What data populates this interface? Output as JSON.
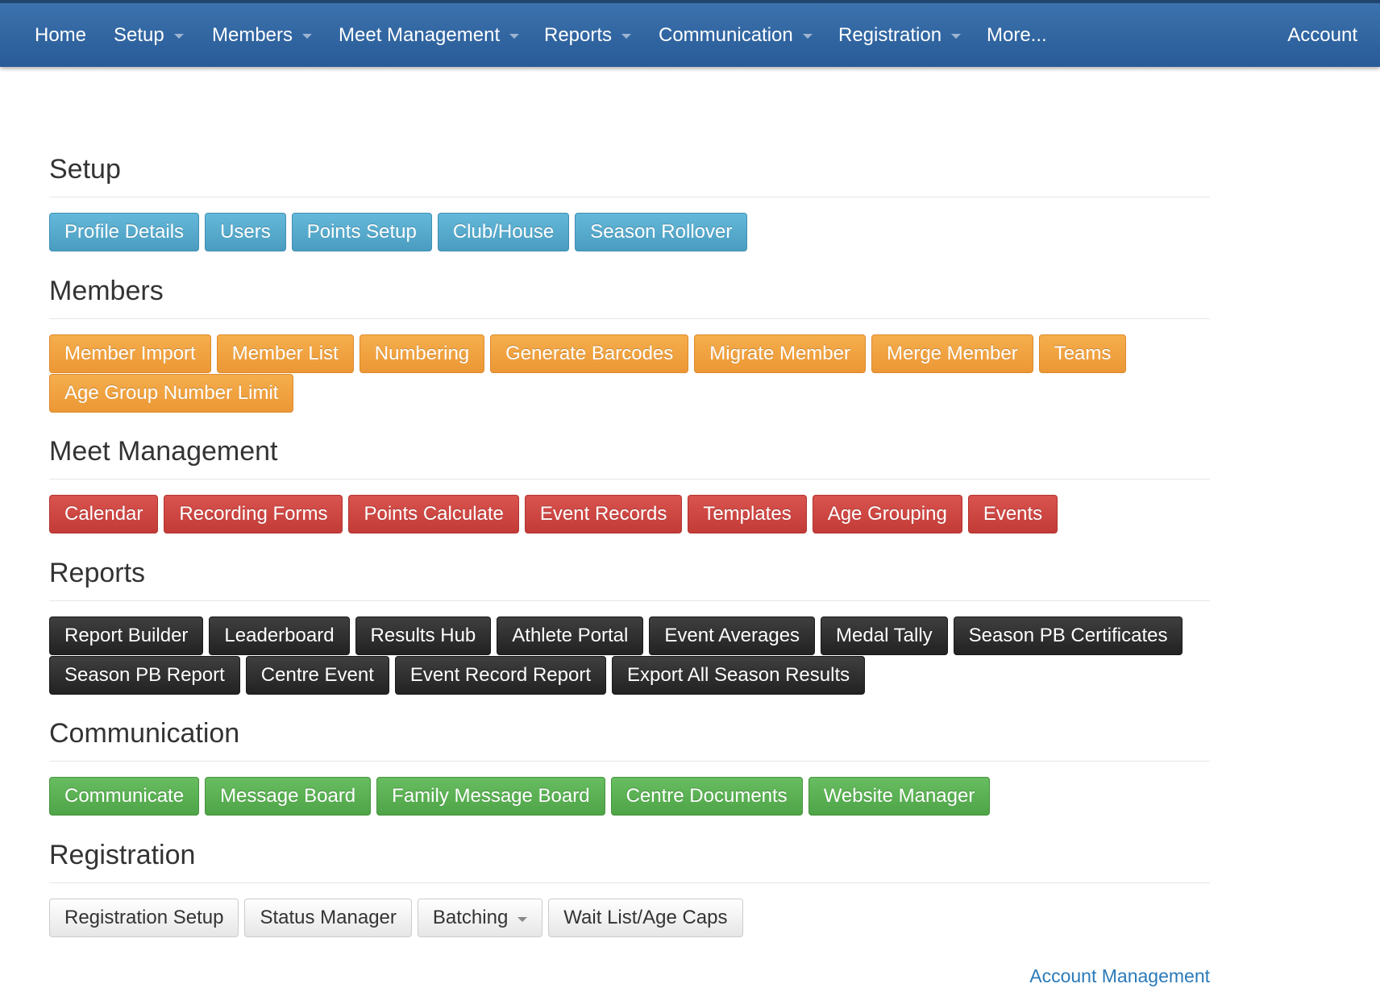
{
  "navbar": {
    "home": "Home",
    "setup": "Setup",
    "members": "Members",
    "meet_management": "Meet Management",
    "reports": "Reports",
    "communication": "Communication",
    "registration": "Registration",
    "more": "More...",
    "account": "Account",
    "bg_color": "#2d64a0"
  },
  "sections": {
    "setup": {
      "title": "Setup",
      "color": "#5bb0d4",
      "buttons": [
        "Profile Details",
        "Users",
        "Points Setup",
        "Club/House",
        "Season Rollover"
      ]
    },
    "members": {
      "title": "Members",
      "color": "#f0a240",
      "buttons": [
        "Member Import",
        "Member List",
        "Numbering",
        "Generate Barcodes",
        "Migrate Member",
        "Merge Member",
        "Teams",
        "Age Group Number Limit"
      ]
    },
    "meet_management": {
      "title": "Meet Management",
      "color": "#cf4642",
      "buttons": [
        "Calendar",
        "Recording Forms",
        "Points Calculate",
        "Event Records",
        "Templates",
        "Age Grouping",
        "Events"
      ]
    },
    "reports": {
      "title": "Reports",
      "color": "#2f2f2f",
      "buttons": [
        "Report Builder",
        "Leaderboard",
        "Results Hub",
        "Athlete Portal",
        "Event Averages",
        "Medal Tally",
        "Season PB Certificates",
        "Season PB Report",
        "Centre Event",
        "Event Record Report",
        "Export All Season Results"
      ]
    },
    "communication": {
      "title": "Communication",
      "color": "#5cb155",
      "buttons": [
        "Communicate",
        "Message Board",
        "Family Message Board",
        "Centre Documents",
        "Website Manager"
      ]
    },
    "registration": {
      "title": "Registration",
      "color": "#f2f2f2",
      "buttons": [
        "Registration Setup",
        "Status Manager",
        "Batching",
        "Wait List/Age Caps"
      ]
    }
  },
  "footer": {
    "account_management": "Account Management"
  }
}
